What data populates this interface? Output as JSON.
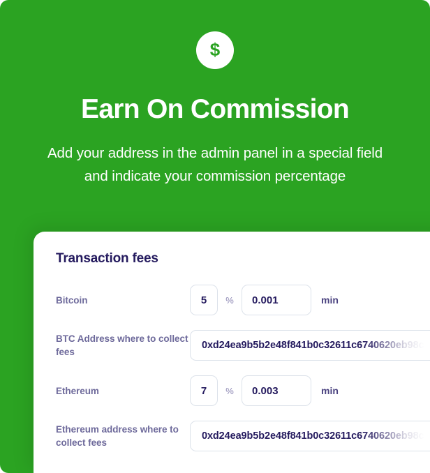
{
  "promo": {
    "icon": "dollar-circle-icon",
    "title": "Earn On Commission",
    "subtitle": "Add your address in the admin panel in a special field and indicate your commission percentage",
    "background_color": "#2BA322",
    "text_color": "#FFFFFF"
  },
  "card": {
    "title": "Transaction fees",
    "title_color": "#241A5E",
    "label_color": "#6E6A9B",
    "border_color": "#DCE2EA",
    "rows": [
      {
        "label": "Bitcoin",
        "percent_value": "5",
        "percent_unit": "%",
        "min_value": "0.001",
        "min_unit": "min"
      },
      {
        "label": "BTC Address where to collect fees",
        "address_value": "0xd24ea9b5b2e48f841b0c32611c6740620eb98c"
      },
      {
        "label": "Ethereum",
        "percent_value": "7",
        "percent_unit": "%",
        "min_value": "0.003",
        "min_unit": "min"
      },
      {
        "label": "Ethereum address where to collect fees",
        "address_value": "0xd24ea9b5b2e48f841b0c32611c6740620eb98c"
      }
    ]
  }
}
